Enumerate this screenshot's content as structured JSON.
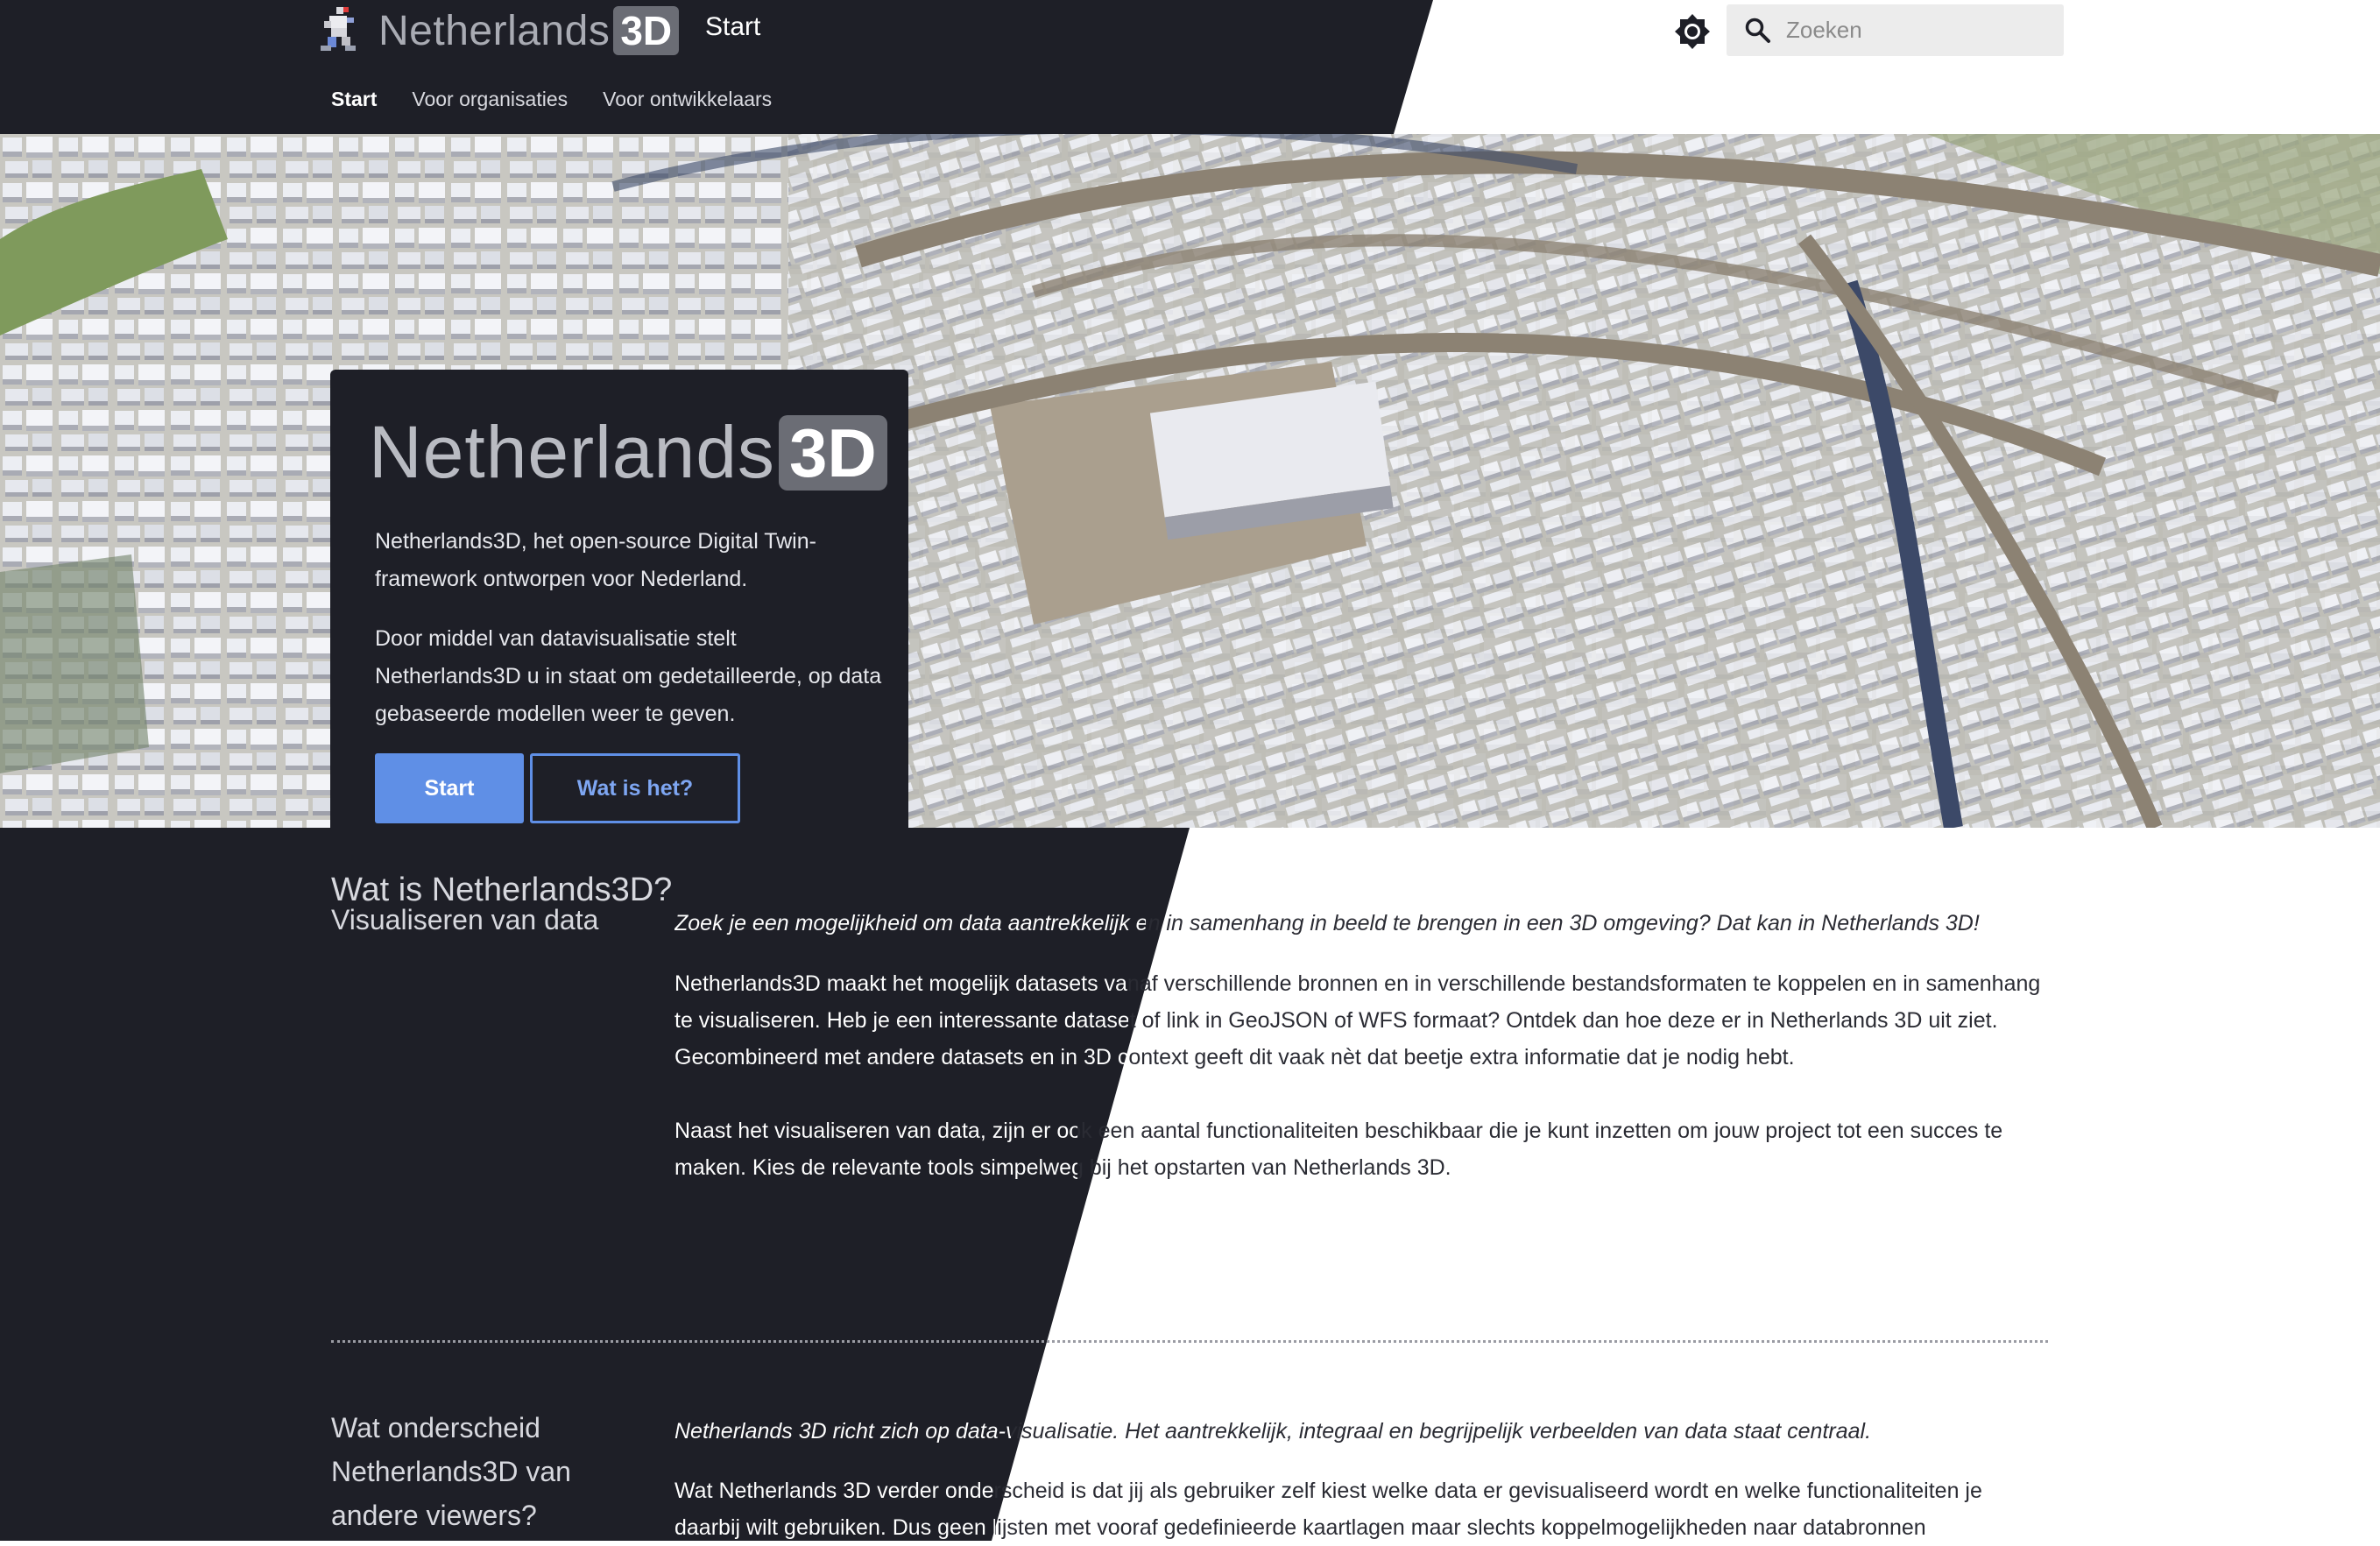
{
  "header": {
    "logo_text": "Netherlands",
    "logo_badge": "3D",
    "title": "Start",
    "nav": [
      {
        "label": "Start",
        "active": true
      },
      {
        "label": "Voor organisaties",
        "active": false
      },
      {
        "label": "Voor ontwikkelaars",
        "active": false
      }
    ],
    "search_placeholder": "Zoeken",
    "theme_icon": "brightness-icon",
    "search_icon": "search-icon"
  },
  "hero": {
    "logo_text": "Netherlands",
    "logo_badge": "3D",
    "paragraph1": "Netherlands3D, het open-source Digital Twin-framework ontworpen voor Nederland.",
    "paragraph2": "Door middel van datavisualisatie stelt Netherlands3D u in staat om gedetailleerde, op data gebaseerde modellen weer te geven.",
    "button_start": "Start",
    "button_what": "Wat is het?"
  },
  "content": {
    "section_title": "Wat is Netherlands3D?",
    "block1": {
      "heading": "Visualiseren van data",
      "lead": "Zoek je een mogelijkheid om data aantrekkelijk en in samenhang in beeld te brengen in een 3D omgeving? Dat kan in Netherlands 3D!",
      "para1": "Netherlands3D maakt het mogelijk datasets vanaf verschillende bronnen en in verschillende bestandsformaten te koppelen en in samenhang te visualiseren. Heb je een interessante dataset of link in GeoJSON of WFS formaat? Ontdek dan hoe deze er in Netherlands 3D uit ziet. Gecombineerd met andere datasets en in 3D context geeft dit vaak nèt dat beetje extra informatie dat je nodig hebt.",
      "para2": "Naast het visualiseren van data, zijn er ook een aantal functionaliteiten beschikbaar die je kunt inzetten om jouw project tot een succes te maken. Kies de relevante tools simpelweg bij het opstarten van Netherlands 3D."
    },
    "block2": {
      "heading": "Wat onderscheid Netherlands3D van andere viewers?",
      "lead": "Netherlands 3D richt zich op data-visualisatie. Het aantrekkelijk, integraal en begrijpelijk verbeelden van data staat centraal.",
      "para1": "Wat Netherlands 3D verder onderscheid is dat jij als gebruiker zelf kiest welke data er gevisualiseerd wordt en welke functionaliteiten je daarbij wilt gebruiken. Dus geen lijsten met vooraf gedefinieerde kaartlagen maar slechts koppelmogelijkheden naar databronnen"
    }
  },
  "colors": {
    "dark": "#1e1f27",
    "accent": "#5f8fe6"
  }
}
